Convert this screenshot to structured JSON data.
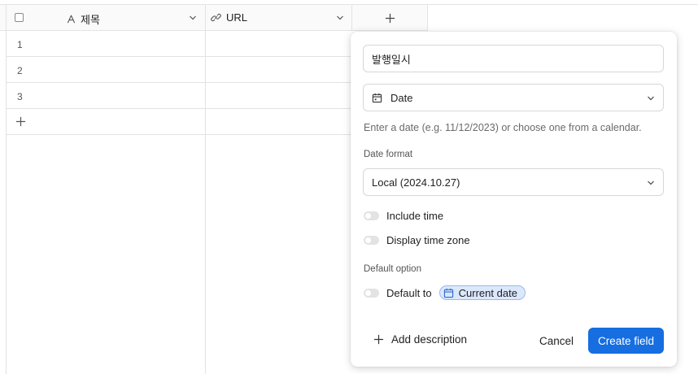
{
  "grid": {
    "columns": [
      {
        "name": "제목",
        "icon": "text-type-icon"
      },
      {
        "name": "URL",
        "icon": "link-icon"
      }
    ],
    "add_column_icon": "plus-icon",
    "rows": [
      {
        "number": "1"
      },
      {
        "number": "2"
      },
      {
        "number": "3"
      }
    ],
    "add_row_icon": "plus-icon"
  },
  "panel": {
    "field_name_value": "발행일시",
    "field_type": {
      "label": "Date",
      "icon": "calendar-icon"
    },
    "help_text": "Enter a date (e.g. 11/12/2023) or choose one from a calendar.",
    "date_format_label": "Date format",
    "date_format_value": "Local (2024.10.27)",
    "include_time_label": "Include time",
    "display_time_zone_label": "Display time zone",
    "default_option_label": "Default option",
    "default_to_label": "Default to",
    "default_chip_label": "Current date",
    "add_description_label": "Add description",
    "cancel_label": "Cancel",
    "create_label": "Create field"
  },
  "colors": {
    "accent": "#166ee1",
    "chip_bg": "#dbe8fc",
    "grid_line": "#e3e3e3"
  }
}
